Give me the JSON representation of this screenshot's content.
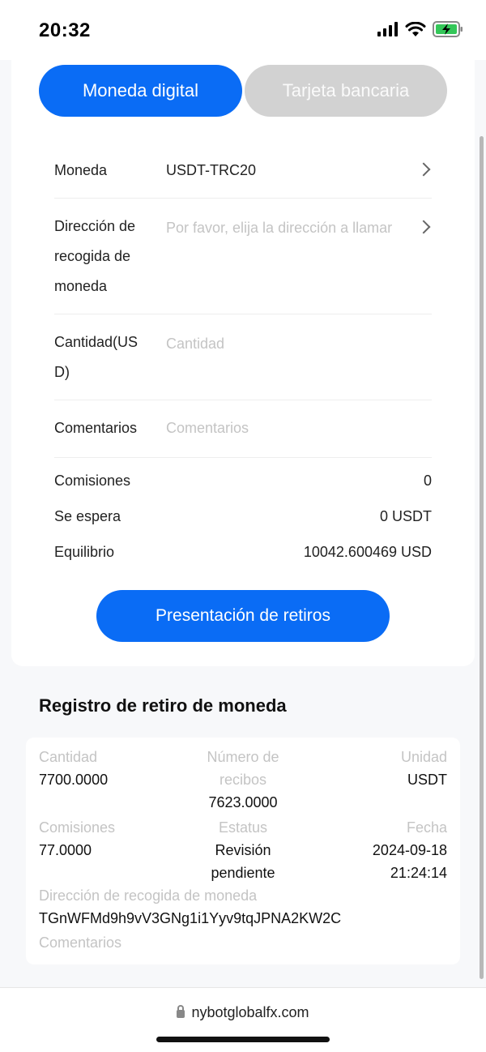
{
  "status": {
    "time": "20:32"
  },
  "tabs": [
    {
      "label": "Moneda digital",
      "active": true
    },
    {
      "label": "Tarjeta bancaria",
      "active": false
    }
  ],
  "form": {
    "coin": {
      "label": "Moneda",
      "value": "USDT-TRC20"
    },
    "address": {
      "label": "Dirección de recogida de moneda",
      "placeholder": "Por favor, elija la dirección a llamar"
    },
    "amount": {
      "label": "Cantidad(USD)",
      "placeholder": "Cantidad"
    },
    "comments": {
      "label": "Comentarios",
      "placeholder": "Comentarios"
    }
  },
  "summary": {
    "fees": {
      "label": "Comisiones",
      "value": "0"
    },
    "expected": {
      "label": "Se espera",
      "value": "0 USDT"
    },
    "balance": {
      "label": "Equilibrio",
      "value": "10042.600469 USD"
    }
  },
  "submit_label": "Presentación de retiros",
  "records": {
    "title": "Registro de retiro de moneda",
    "item": {
      "amount_label": "Cantidad",
      "amount": "7700.0000",
      "receipts_label": "Número de recibos",
      "receipts": "7623.0000",
      "unit_label": "Unidad",
      "unit": "USDT",
      "fees_label": "Comisiones",
      "fees": "77.0000",
      "status_label": "Estatus",
      "status": "Revisión pendiente",
      "date_label": "Fecha",
      "date": "2024-09-18",
      "time": "21:24:14",
      "address_label": "Dirección de recogida de moneda",
      "address": "TGnWFMd9h9vV3GNg1i1Yyv9tqJPNA2KW2C",
      "comments_label": "Comentarios"
    }
  },
  "browser": {
    "url": "nybotglobalfx.com"
  },
  "colors": {
    "accent": "#0a6cf5",
    "tab_inactive": "#d2d2d2",
    "placeholder": "#c4c4c4"
  }
}
